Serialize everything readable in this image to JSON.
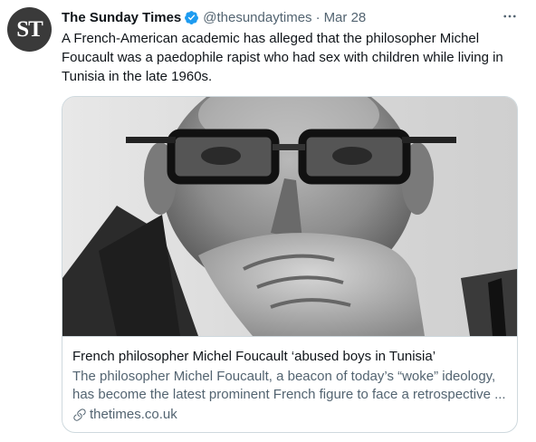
{
  "account": {
    "avatar_initials": "ST",
    "display_name": "The Sunday Times",
    "handle": "@thesundaytimes",
    "separator": "·",
    "date": "Mar 28",
    "verified_icon": "verified-badge-icon",
    "more_icon": "more-options-icon"
  },
  "tweet": {
    "text": "A French-American academic has alleged that the philosopher Michel Foucault was a paedophile rapist who had sex with children while living in Tunisia in the late 1960s."
  },
  "card": {
    "image_subject": "black-and-white photo of man with glasses, hand at chin",
    "title": "French philosopher Michel Foucault ‘abused boys in Tunisia’",
    "description": "The philosopher Michel Foucault, a beacon of today’s “woke” ideology, has become the latest prominent French figure to face a retrospective ...",
    "domain": "thetimes.co.uk",
    "link_icon": "link-icon"
  },
  "colors": {
    "text_primary": "#0f1419",
    "text_secondary": "#536471",
    "verified_blue": "#1d9bf0",
    "border": "#cfd9de"
  }
}
